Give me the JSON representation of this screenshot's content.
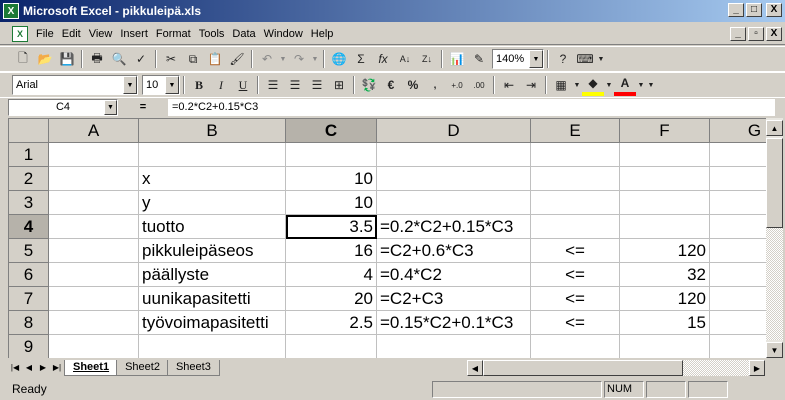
{
  "window": {
    "title": "Microsoft Excel - pikkuleipä.xls",
    "min": "_",
    "max": "□",
    "close": "X"
  },
  "menu": [
    "File",
    "Edit",
    "View",
    "Insert",
    "Format",
    "Tools",
    "Data",
    "Window",
    "Help"
  ],
  "toolbar": {
    "zoom": "140%",
    "font": "Arial",
    "size": "10",
    "bold": "B",
    "italic": "I",
    "underline": "U",
    "currency": "€",
    "percent": "%"
  },
  "formula_bar": {
    "name_box": "C4",
    "equals": "=",
    "formula": "=0.2*C2+0.15*C3"
  },
  "columns": [
    "A",
    "B",
    "C",
    "D",
    "E",
    "F",
    "G"
  ],
  "rows": [
    "1",
    "2",
    "3",
    "4",
    "5",
    "6",
    "7",
    "8",
    "9"
  ],
  "cells": {
    "B2": "x",
    "C2": "10",
    "B3": "y",
    "C3": "10",
    "B4": "tuotto",
    "C4": "3.5",
    "D4": "=0.2*C2+0.15*C3",
    "B5": "pikkuleipäseos",
    "C5": "16",
    "D5": "=C2+0.6*C3",
    "E5": "<=",
    "F5": "120",
    "B6": "päällyste",
    "C6": "4",
    "D6": "=0.4*C2",
    "E6": "<=",
    "F6": "32",
    "B7": "uunikapasitetti",
    "C7": "20",
    "D7": "=C2+C3",
    "E7": "<=",
    "F7": "120",
    "B8": "työvoimapasitetti",
    "C8": "2.5",
    "D8": "=0.15*C2+0.1*C3",
    "E8": "<=",
    "F8": "15"
  },
  "sheets": [
    "Sheet1",
    "Sheet2",
    "Sheet3"
  ],
  "status": {
    "text": "Ready",
    "num": "NUM"
  }
}
